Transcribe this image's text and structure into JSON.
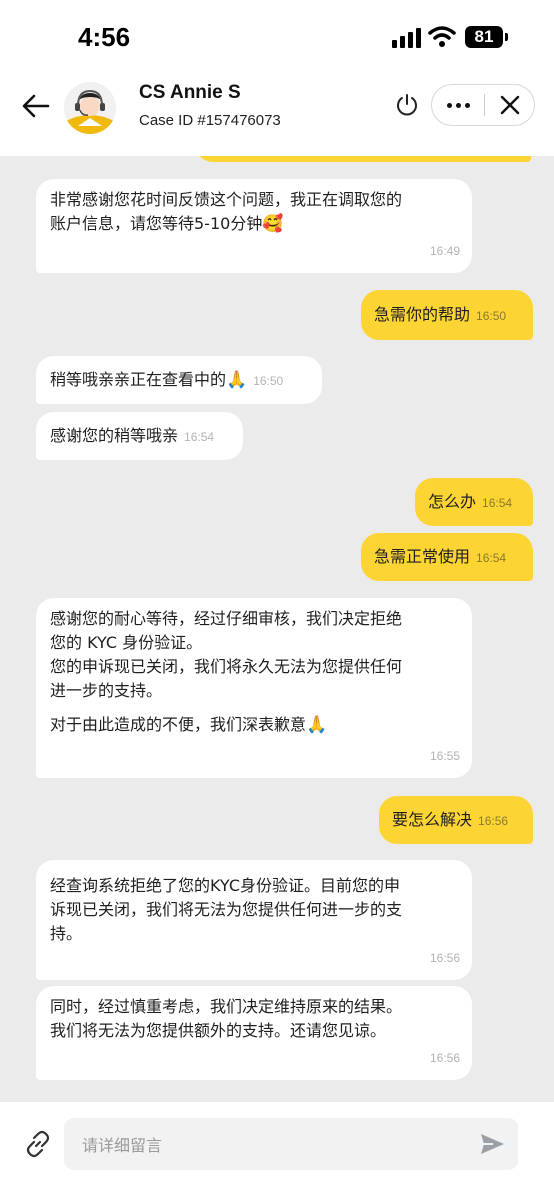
{
  "status_bar": {
    "time": "4:56",
    "battery": "81"
  },
  "header": {
    "agent_name": "CS Annie S",
    "case_id": "Case ID #157476073"
  },
  "messages": {
    "m1": {
      "text": "非常感谢您花时间反馈这个问题，我正在调取您的\n账户信息，请您等待5-10分钟",
      "emoji": "🥰",
      "time": "16:49"
    },
    "m2": {
      "text": "急需你的帮助",
      "time": "16:50"
    },
    "m3": {
      "text": "稍等哦亲亲正在查看中的",
      "emoji": "🙏",
      "time": "16:50"
    },
    "m4": {
      "text": "感谢您的稍等哦亲",
      "time": "16:54"
    },
    "m5": {
      "text": "怎么办",
      "time": "16:54"
    },
    "m6": {
      "text": "急需正常使用",
      "time": "16:54"
    },
    "m7": {
      "text": "感谢您的耐心等待，经过仔细审核，我们决定拒绝\n您的 KYC 身份验证。\n您的申诉现已关闭，我们将永久无法为您提供任何\n进一步的支持。",
      "text2": "对于由此造成的不便，我们深表歉意",
      "emoji": "🙏",
      "time": "16:55"
    },
    "m8": {
      "text": "要怎么解决",
      "time": "16:56"
    },
    "m9": {
      "text": "经查询系统拒绝了您的KYC身份验证。目前您的申\n诉现已关闭，我们将无法为您提供任何进一步的支\n持。",
      "time": "16:56"
    },
    "m10": {
      "text": "同时，经过慎重考虑，我们决定维持原来的结果。\n我们将无法为您提供额外的支持。还请您见谅。",
      "time": "16:56"
    }
  },
  "input": {
    "placeholder": "请详细留言"
  },
  "colors": {
    "user_bubble": "#fcd535",
    "agent_bubble": "#ffffff",
    "chat_bg": "#ebebeb"
  },
  "icons": [
    "back-arrow-icon",
    "power-icon",
    "more-icon",
    "close-icon",
    "link-icon",
    "send-icon"
  ]
}
